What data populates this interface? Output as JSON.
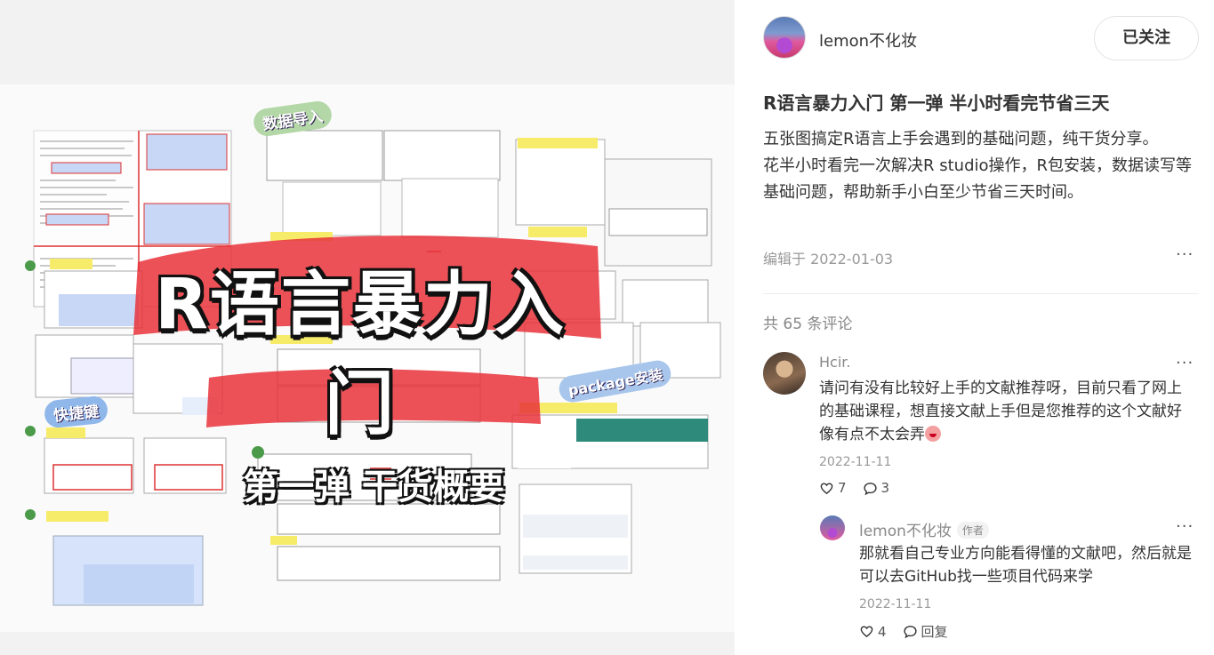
{
  "poster": {
    "title": "R语言暴力入门",
    "subtitle": "第一弹 干货概要",
    "tags": {
      "import": "数据导入",
      "shortcut": "快捷键",
      "package": "package安装"
    }
  },
  "author": {
    "name": "lemon不化妆",
    "follow_label": "已关注"
  },
  "note": {
    "title": "R语言暴力入门 第一弹 半小时看完节省三天",
    "desc_1": "五张图搞定R语言上手会遇到的基础问题，纯干货分享。",
    "desc_2": "花半小时看完一次解决R studio操作，R包安装，数据读写等基础问题，帮助新手小白至少节省三天时间。",
    "edit_date": "编辑于 2022-01-03",
    "more": "···"
  },
  "comments": {
    "count_label": "共 65 条评论",
    "items": [
      {
        "name": "Hcir.",
        "text": "请问有没有比较好上手的文献推荐呀，目前只看了网上的基础课程，想直接文献上手但是您推荐的这个文献好像有点不太会弄",
        "date": "2022-11-11",
        "likes": "7",
        "replies": "3",
        "more": "···"
      },
      {
        "name": "lemon不化妆",
        "badge": "作者",
        "text": "那就看自己专业方向能看得懂的文献吧，然后就是可以去GitHub找一些项目代码来学",
        "date": "2022-11-11",
        "likes": "4",
        "reply_label": "回复",
        "more": "···"
      }
    ]
  },
  "colors": {
    "accent_red": "#e8333a",
    "muted": "#999999",
    "text": "#333333"
  }
}
